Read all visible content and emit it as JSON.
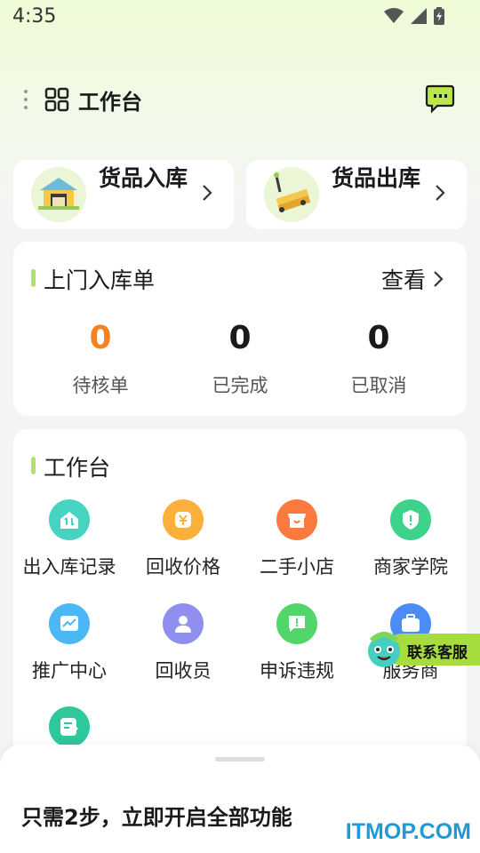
{
  "status_bar": {
    "time": "4:35"
  },
  "header": {
    "title": "工作台",
    "menu_icon": "grid-icon",
    "message_icon": "chat-bubble-icon"
  },
  "quick_actions": [
    {
      "label": "货品入库",
      "icon": "warehouse-icon"
    },
    {
      "label": "货品出库",
      "icon": "pallet-truck-icon"
    }
  ],
  "orders": {
    "title": "上门入库单",
    "view_label": "查看",
    "stats": [
      {
        "value": "0",
        "label": "待核单",
        "color": "#f5811f"
      },
      {
        "value": "0",
        "label": "已完成",
        "color": "#111111"
      },
      {
        "value": "0",
        "label": "已取消",
        "color": "#111111"
      }
    ]
  },
  "workbench": {
    "title": "工作台",
    "items": [
      {
        "label": "出入库记录",
        "icon": "in-out-record-icon",
        "color": "#46d3c1"
      },
      {
        "label": "回收价格",
        "icon": "yen-price-icon",
        "color": "#fbb03b"
      },
      {
        "label": "二手小店",
        "icon": "shop-icon",
        "color": "#fd7a3f"
      },
      {
        "label": "商家学院",
        "icon": "shield-icon",
        "color": "#3dd38a"
      },
      {
        "label": "推广中心",
        "icon": "trend-chart-icon",
        "color": "#4cb7f5"
      },
      {
        "label": "回收员",
        "icon": "person-icon",
        "color": "#8f8ff0"
      },
      {
        "label": "申诉违规",
        "icon": "alert-chat-icon",
        "color": "#52d66a"
      },
      {
        "label": "服务商",
        "icon": "briefcase-icon",
        "color": "#4b8df5"
      },
      {
        "label": "",
        "icon": "edit-note-icon",
        "color": "#2fc79c"
      }
    ]
  },
  "customer_service": {
    "label": "联系客服"
  },
  "bottom_sheet": {
    "text": "只需2步，立即开启全部功能"
  },
  "watermark": "ITMOP.COM"
}
